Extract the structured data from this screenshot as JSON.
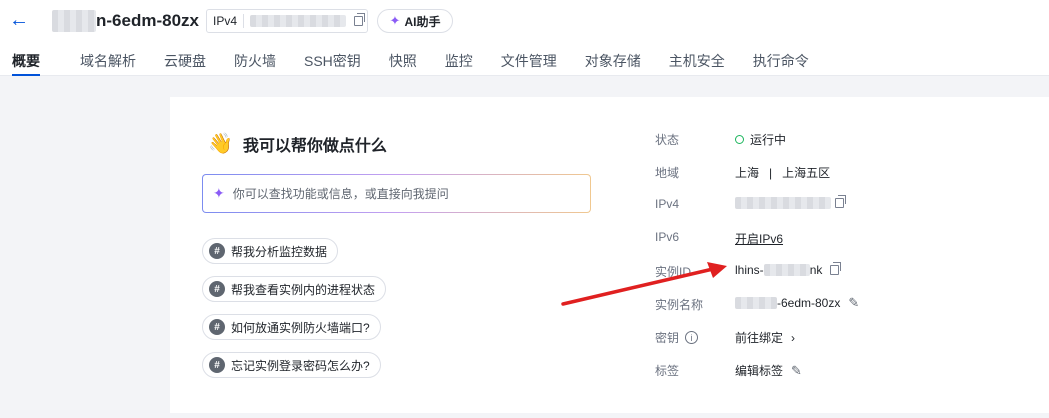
{
  "header": {
    "back_icon": "arrow-left-icon",
    "instance_title": "n-6edm-80zx",
    "ip_type": "IPv4",
    "ai_button": "AI助手"
  },
  "tabs": [
    "概要",
    "域名解析",
    "云硬盘",
    "防火墙",
    "SSH密钥",
    "快照",
    "监控",
    "文件管理",
    "对象存储",
    "主机安全",
    "执行命令"
  ],
  "assistant": {
    "title": "我可以帮你做点什么",
    "input_placeholder": "你可以查找功能或信息，或直接向我提问",
    "suggestions": [
      "帮我分析监控数据",
      "帮我查看实例内的进程状态",
      "如何放通实例防火墙端口?",
      "忘记实例登录密码怎么办?"
    ]
  },
  "info": {
    "status_label": "状态",
    "status_value": "运行中",
    "region_label": "地域",
    "region_city": "上海",
    "region_sep": "|",
    "region_zone": "上海五区",
    "ipv4_label": "IPv4",
    "ipv6_label": "IPv6",
    "ipv6_action": "开启IPv6",
    "instance_id_label": "实例ID",
    "instance_id_prefix": "lhins-",
    "instance_id_suffix": "nk",
    "instance_name_label": "实例名称",
    "instance_name_suffix": "-6edm-80zx",
    "key_label": "密钥",
    "key_action": "前往绑定",
    "tag_label": "标签",
    "tag_action": "编辑标签"
  },
  "colors": {
    "accent": "#0052d9",
    "running": "#1bb55c",
    "arrow": "#e02020"
  }
}
